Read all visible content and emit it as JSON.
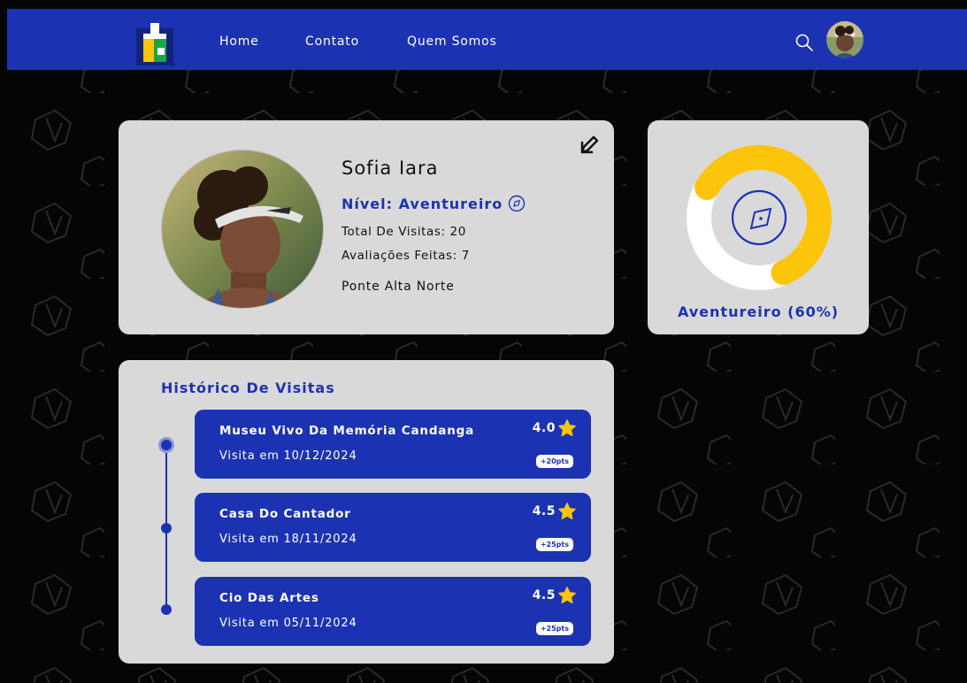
{
  "nav": {
    "links": [
      "Home",
      "Contato",
      "Quem Somos"
    ],
    "brand_color": "#1b33b3",
    "icons": [
      "search-icon",
      "avatar"
    ]
  },
  "profile": {
    "name": "Sofia Iara",
    "level_label": "Nível: Aventureiro",
    "total_visits": "Total De Visitas: 20",
    "reviews_done": "Avaliações Feitas: 7",
    "location": "Ponte Alta Norte"
  },
  "level": {
    "label": "Aventureiro (60%)",
    "progress": 0.6,
    "progress_color": "#fcc40b",
    "track_color": "#ffffff"
  },
  "history": {
    "title": "Histórico De Visitas",
    "visits": [
      {
        "name": "Museu Vivo Da Memória Candanga",
        "date": "Visita em 10/12/2024",
        "rating": "4.0",
        "points": "+20pts"
      },
      {
        "name": "Casa Do Cantador",
        "date": "Visita em 18/11/2024",
        "rating": "4.5",
        "points": "+25pts"
      },
      {
        "name": "Cio Das Artes",
        "date": "Visita em 05/11/2024",
        "rating": "4.5",
        "points": "+25pts"
      }
    ]
  }
}
